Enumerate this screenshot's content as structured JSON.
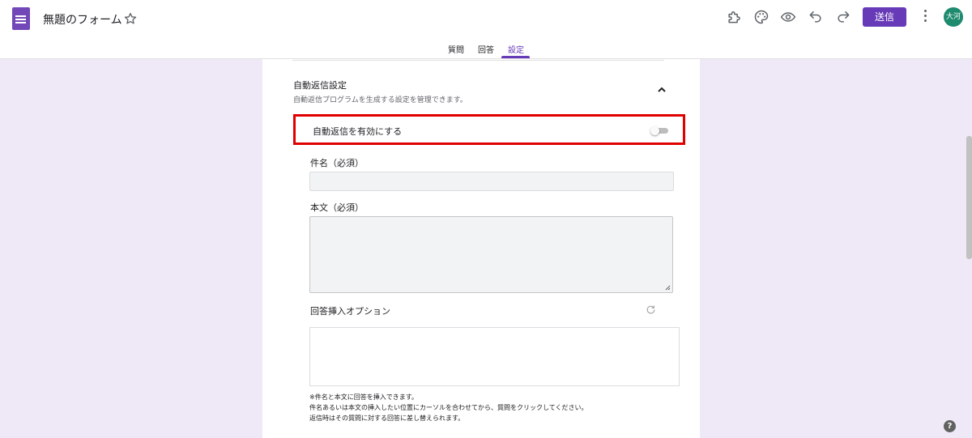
{
  "app": {
    "title": "無題のフォーム",
    "icons": [
      "forms-logo-icon",
      "star-icon",
      "addon-puzzle-icon",
      "palette-icon",
      "preview-eye-icon",
      "undo-icon",
      "redo-icon",
      "more-vert-icon",
      "help-icon"
    ],
    "accent_color": "#673ab7"
  },
  "toolbar": {
    "send_label": "送信",
    "avatar_text": "大河"
  },
  "tabs": [
    {
      "label": "質問",
      "active": false
    },
    {
      "label": "回答",
      "active": false
    },
    {
      "label": "設定",
      "active": true
    }
  ],
  "settings": {
    "section_title": "自動返信設定",
    "section_desc": "自動返信プログラムを生成する設定を管理できます。",
    "toggle_label": "自動返信を有効にする",
    "toggle_on": false,
    "subject_label": "件名（必須）",
    "subject_value": "",
    "body_label": "本文（必須）",
    "body_value": "",
    "options_label": "回答挿入オプション",
    "notes": [
      "※件名と本文に回答を挿入できます。",
      "件名あるいは本文の挿入したい位置にカーソルを合わせてから、質問をクリックしてください。",
      "返信時はその質問に対する回答に差し替えられます。"
    ]
  },
  "highlight_color": "#e00000",
  "help_text": "?"
}
